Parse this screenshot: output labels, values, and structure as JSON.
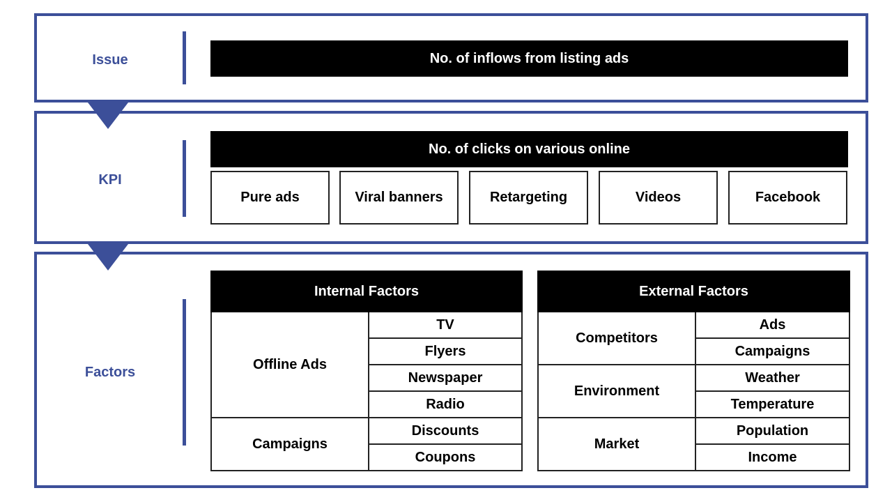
{
  "colors": {
    "accent": "#3c4f99",
    "header_bg": "#000000",
    "header_text": "#ffffff"
  },
  "issue": {
    "label": "Issue",
    "header": "No. of inflows from listing ads"
  },
  "kpi": {
    "label": "KPI",
    "header": "No. of clicks on various online",
    "items": [
      "Pure ads",
      "Viral banners",
      "Retargeting",
      "Videos",
      "Facebook"
    ]
  },
  "factors": {
    "label": "Factors",
    "internal": {
      "title": "Internal Factors",
      "groups": [
        {
          "name": "Offline Ads",
          "items": [
            "TV",
            "Flyers",
            "Newspaper",
            "Radio"
          ]
        },
        {
          "name": "Campaigns",
          "items": [
            "Discounts",
            "Coupons"
          ]
        }
      ]
    },
    "external": {
      "title": "External Factors",
      "groups": [
        {
          "name": "Competitors",
          "items": [
            "Ads",
            "Campaigns"
          ]
        },
        {
          "name": "Environment",
          "items": [
            "Weather",
            "Temperature"
          ]
        },
        {
          "name": "Market",
          "items": [
            "Population",
            "Income"
          ]
        }
      ]
    }
  }
}
